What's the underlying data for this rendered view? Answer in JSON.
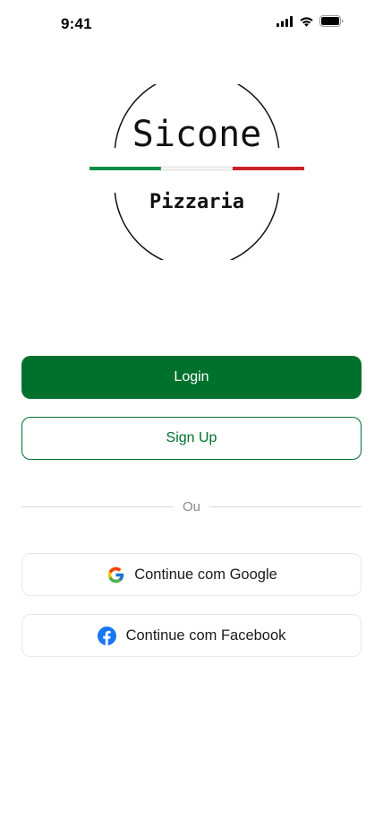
{
  "status_bar": {
    "time": "9:41",
    "icons": [
      "cellular-signal-icon",
      "wifi-icon",
      "battery-icon"
    ]
  },
  "logo": {
    "title": "Sicone",
    "subtitle": "Pizzaria",
    "colors": {
      "green": "#008c45",
      "white": "#f4f5f0",
      "red": "#cd212a"
    }
  },
  "actions": {
    "login_label": "Login",
    "signup_label": "Sign Up"
  },
  "divider": {
    "label": "Ou"
  },
  "social": {
    "google_label": "Continue com Google",
    "google_icon": "google-icon",
    "facebook_label": "Continue com Facebook",
    "facebook_icon": "facebook-icon"
  },
  "theme": {
    "primary": "#00712d",
    "background": "#ffffff",
    "facebook_blue": "#1877f2"
  }
}
